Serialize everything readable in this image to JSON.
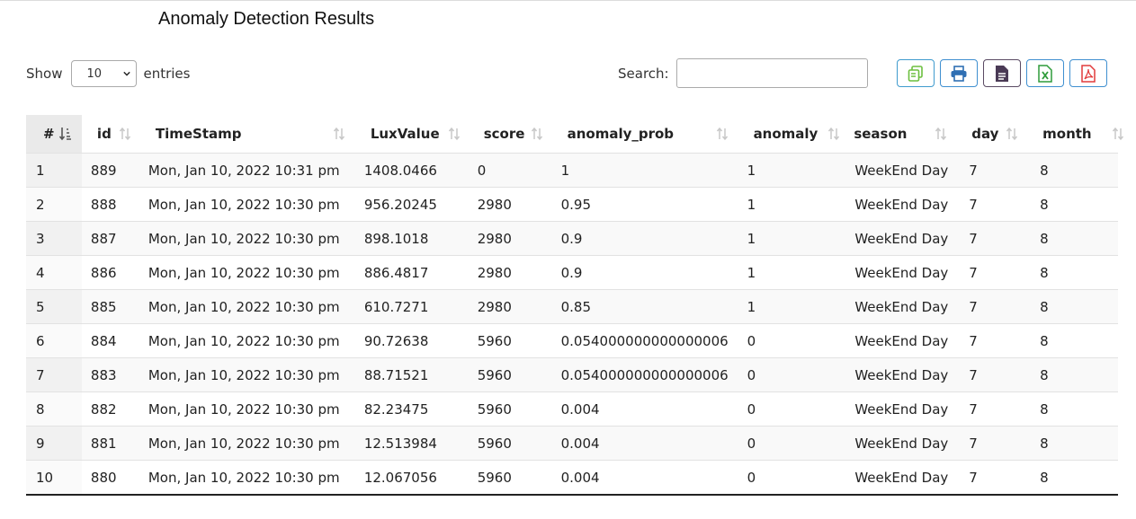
{
  "title": "Anomaly Detection Results",
  "length": {
    "label_before": "Show",
    "value": "10",
    "label_after": "entries"
  },
  "search": {
    "label": "Search:",
    "value": ""
  },
  "export_buttons": [
    {
      "icon": "copy-icon",
      "color": "#5cb85c"
    },
    {
      "icon": "print-icon",
      "color": "#3f8fd0"
    },
    {
      "icon": "csv-icon",
      "color": "#5a4a63"
    },
    {
      "icon": "excel-icon",
      "color": "#2e9b3a"
    },
    {
      "icon": "pdf-icon",
      "color": "#e23c3c"
    }
  ],
  "table": {
    "columns": [
      "#",
      "id",
      "TimeStamp",
      "LuxValue",
      "score",
      "anomaly_prob",
      "anomaly",
      "season",
      "day",
      "month"
    ],
    "rows": [
      [
        "1",
        "889",
        "Mon, Jan 10, 2022 10:31 pm",
        "1408.0466",
        "0",
        "1",
        "1",
        "WeekEnd Day",
        "7",
        "8"
      ],
      [
        "2",
        "888",
        "Mon, Jan 10, 2022 10:30 pm",
        "956.20245",
        "2980",
        "0.95",
        "1",
        "WeekEnd Day",
        "7",
        "8"
      ],
      [
        "3",
        "887",
        "Mon, Jan 10, 2022 10:30 pm",
        "898.1018",
        "2980",
        "0.9",
        "1",
        "WeekEnd Day",
        "7",
        "8"
      ],
      [
        "4",
        "886",
        "Mon, Jan 10, 2022 10:30 pm",
        "886.4817",
        "2980",
        "0.9",
        "1",
        "WeekEnd Day",
        "7",
        "8"
      ],
      [
        "5",
        "885",
        "Mon, Jan 10, 2022 10:30 pm",
        "610.7271",
        "2980",
        "0.85",
        "1",
        "WeekEnd Day",
        "7",
        "8"
      ],
      [
        "6",
        "884",
        "Mon, Jan 10, 2022 10:30 pm",
        "90.72638",
        "5960",
        "0.054000000000000006",
        "0",
        "WeekEnd Day",
        "7",
        "8"
      ],
      [
        "7",
        "883",
        "Mon, Jan 10, 2022 10:30 pm",
        "88.71521",
        "5960",
        "0.054000000000000006",
        "0",
        "WeekEnd Day",
        "7",
        "8"
      ],
      [
        "8",
        "882",
        "Mon, Jan 10, 2022 10:30 pm",
        "82.23475",
        "5960",
        "0.004",
        "0",
        "WeekEnd Day",
        "7",
        "8"
      ],
      [
        "9",
        "881",
        "Mon, Jan 10, 2022 10:30 pm",
        "12.513984",
        "5960",
        "0.004",
        "0",
        "WeekEnd Day",
        "7",
        "8"
      ],
      [
        "10",
        "880",
        "Mon, Jan 10, 2022 10:30 pm",
        "12.067056",
        "5960",
        "0.004",
        "0",
        "WeekEnd Day",
        "7",
        "8"
      ]
    ]
  }
}
